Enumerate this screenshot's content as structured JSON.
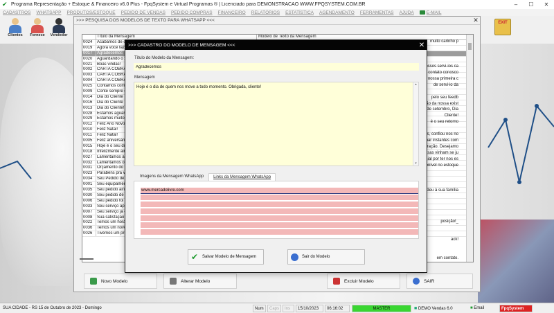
{
  "app": {
    "title": "Programa Representação + Estoque & Financeiro v6.0 Plus - FpqSystem e Virtual Programas ® | Licenciado para  DEMONSTRACAO WWW.FPQSYSTEM.COM.BR",
    "min": "–",
    "max": "☐",
    "close": "✕"
  },
  "menu": [
    "CADASTROS",
    "WHATSAPP",
    "PRODUTOS/ESTOQUE",
    "PEDIDO DE VENDAS",
    "PEDIDO COMPRAS",
    "FINANCEIRO",
    "RELATÓRIOS",
    "ESTATÍSTICA",
    "AGENDAMENTO",
    "FERRAMENTAS",
    "AJUDA"
  ],
  "menu_email": "E-MAIL",
  "toolbar": {
    "clientes": "Clientes",
    "fornece": "Fornece",
    "vendedor": "Vendedor",
    "exit_badge": "EXIT"
  },
  "search": {
    "title": ">>> PESQUISA DOS MODELOS DE TEXTO PARA WHATSAPP <<<",
    "close": "✕",
    "col_titulo": "Título da Mensagem",
    "col_modelo": "Modelo de Texto da Mensagem",
    "rows": [
      [
        "0024",
        "Acabamos de chegar"
      ],
      [
        "0019",
        "Agora você faz"
      ],
      [
        "0017",
        "Agradecemos"
      ],
      [
        "0020",
        "Aguardando o s"
      ],
      [
        "0021",
        "Boas vindas!"
      ],
      [
        "0002",
        "CARTA COBRAN"
      ],
      [
        "0003",
        "CARTA COBRAN"
      ],
      [
        "0004",
        "CARTA COBRAN"
      ],
      [
        "0025",
        "Contamos com"
      ],
      [
        "0009",
        "Conte sempre c"
      ],
      [
        "0014",
        "Dia do Cliente"
      ],
      [
        "0016",
        "Dia do Cliente"
      ],
      [
        "0013",
        "Dia do Cliente!"
      ],
      [
        "0028",
        "Estamos aguard"
      ],
      [
        "0029",
        "Estamos muito f"
      ],
      [
        "0012",
        "Feliz Ano Novo!"
      ],
      [
        "0010",
        "Feliz Natal!"
      ],
      [
        "0011",
        "Feliz Natal!"
      ],
      [
        "0005",
        "Feliz aniversári"
      ],
      [
        "0015",
        "Hoje é o seu dia"
      ],
      [
        "0018",
        "Infelizmente ain"
      ],
      [
        "0027",
        "Lamentamos a s"
      ],
      [
        "0032",
        "Lamentamos o s"
      ],
      [
        "0031",
        "Orçamento do se"
      ],
      [
        "0023",
        "Parabéns pra vo"
      ],
      [
        "0034",
        "Seu Pedido de V"
      ],
      [
        "0001",
        "Seu equipament"
      ],
      [
        "0035",
        "Seu pedido aind"
      ],
      [
        "0030",
        "Seu pedido de v"
      ],
      [
        "0006",
        "Seu pedido foi D"
      ],
      [
        "0033",
        "Seu serviço apre"
      ],
      [
        "0007",
        "Seu serviço já e"
      ],
      [
        "0008",
        "Sua satisfação e"
      ],
      [
        "0022",
        "Temos um horár"
      ],
      [
        "0036",
        "Temos um novo"
      ],
      [
        "0026",
        "Tivemos um prob"
      ]
    ],
    "right_snippets": [
      "muito carinho p",
      "",
      "",
      "",
      "r nossos servi-ios ca",
      "contato conosco",
      "a nossa primeira c",
      "de servi-io da",
      "",
      "pelo seu feedb",
      "ção da nossa exist",
      "de setembro, Dia",
      "Cliente!",
      "é o seu retorno",
      "",
      "nós, confiou nos no",
      "ilhar instantes com",
      "olaboração. Desejamo",
      "nossas vinham se ju",
      "ncial por ter nos es",
      "disponível no estoque",
      "",
      "",
      "",
      "deu à sua família",
      "",
      "",
      "",
      "",
      "posição!_",
      "",
      "",
      "ack!",
      "",
      "",
      "em contato."
    ],
    "btn_novo": "Novo Modelo",
    "btn_alterar": "Alterar Modelo",
    "btn_excluir": "Excluir Modelo",
    "btn_sair": "SAIR"
  },
  "modal": {
    "title": ">>> CADASTRO DO MODELO DE MENSAGEM <<<",
    "close": "✕",
    "label_titulo": "Título do Modelo da Mensagem:",
    "titulo_value": "Agradecemos",
    "label_mensagem": "Mensagem",
    "mensagem_value": "Hoje é o dia de quem nos move a todo momento. Obrigada, cliente!",
    "tab_imagens": "Imagens da Mensagem WhatsApp",
    "tab_links": "Links da Mensagem WhatsApp",
    "links": [
      "www.mercadolivre.com",
      "",
      "",
      "",
      "",
      "",
      ""
    ],
    "btn_salvar": "Salvar Modelo de Mensagem",
    "btn_sair": "Sair do Modelo",
    "scroll_up": "▴",
    "scroll_down": "▾"
  },
  "status": {
    "city": "SUA CIDADE - RS 15 de Outubro de 2023 - Domingo",
    "num": "Num",
    "caps": "Caps",
    "ins": "Ins",
    "date": "15/10/2023",
    "time": "06:16:02",
    "master": "MASTER",
    "demo": "DEMO Vendas 6.0",
    "email": "Email",
    "fpq": "FpqSystem"
  },
  "colors": {
    "modal_title_bg": "#050505",
    "input_bg": "#ffffd9",
    "link_row_bg": "#f3b8b8",
    "selected_row": "#9c9c9c",
    "master_bg": "#39d631"
  }
}
